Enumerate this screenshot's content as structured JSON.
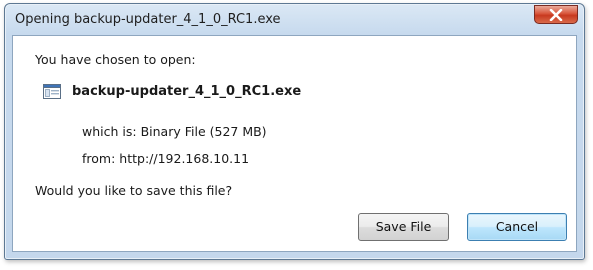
{
  "window": {
    "title": "Opening backup-updater_4_1_0_RC1.exe",
    "close_icon": "close-x-icon"
  },
  "dialog": {
    "prompt": "You have chosen to open:",
    "file_icon": "executable-file-icon",
    "filename": "backup-updater_4_1_0_RC1.exe",
    "which_is_label": "which is:",
    "which_is_value": "Binary File (527 MB)",
    "from_label": "from:",
    "from_value": "http://192.168.10.11",
    "question": "Would you like to save this file?"
  },
  "buttons": {
    "save_label": "Save File",
    "cancel_label": "Cancel"
  }
}
